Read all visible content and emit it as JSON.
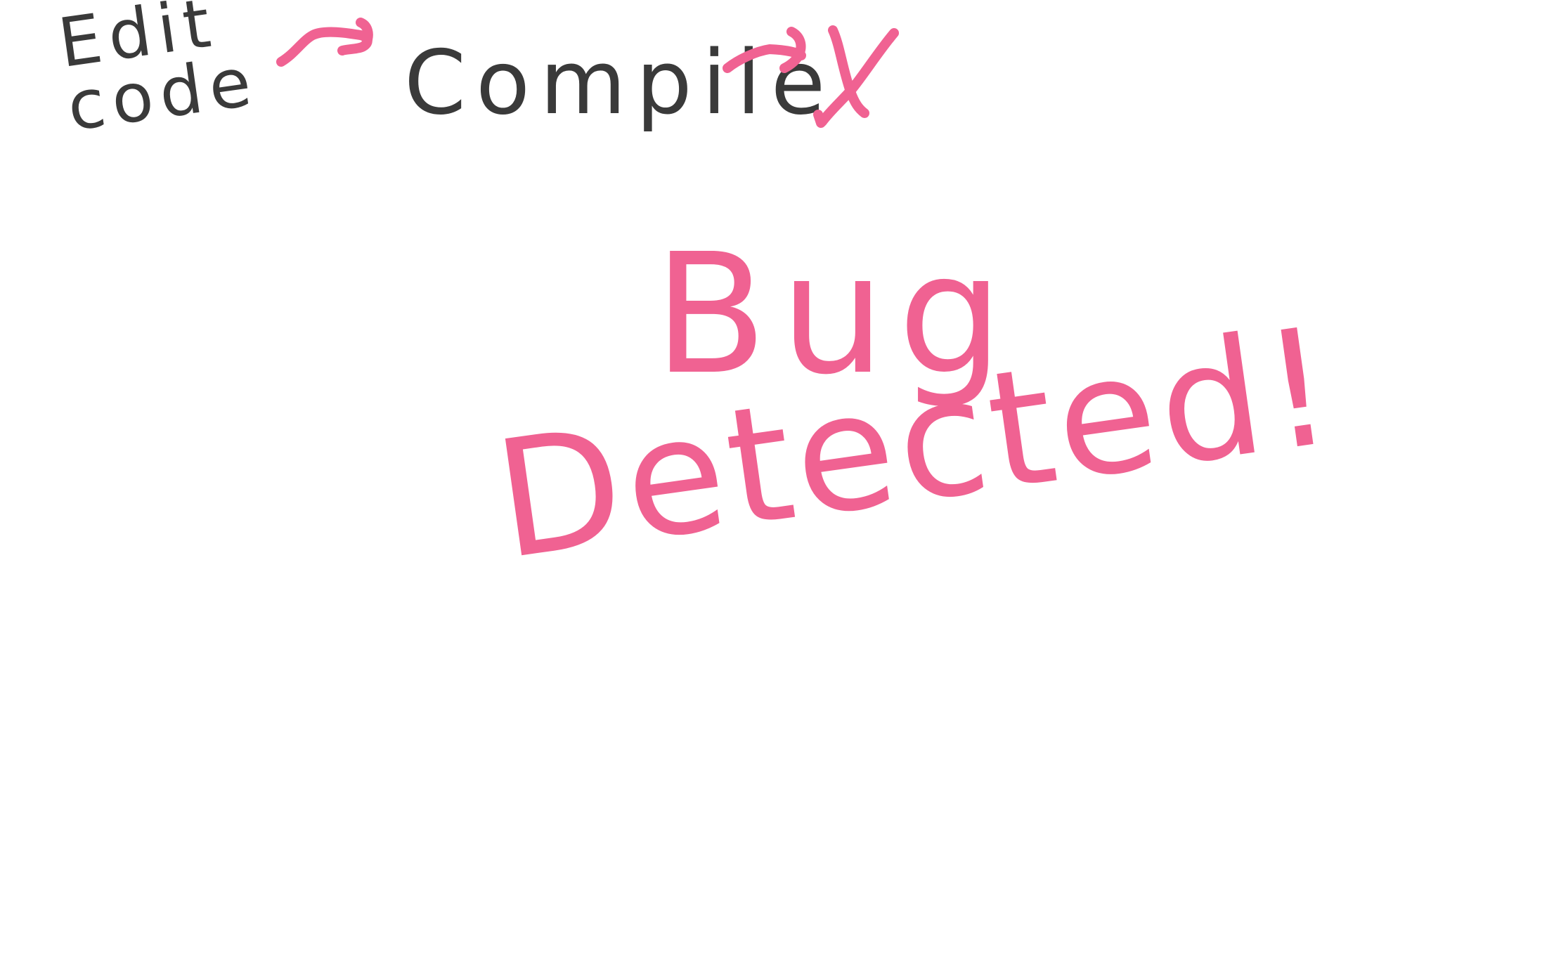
{
  "steps": {
    "edit_code": "Edit\ncode",
    "compile": "Compile",
    "fail_mark": "X"
  },
  "message": {
    "line1": "Bug",
    "line2": "Detected!"
  },
  "colors": {
    "ink_dark": "#3a3a3a",
    "ink_pink": "#f06292",
    "background": "#ffffff"
  },
  "icons": {
    "arrow_1": "arrow-right-icon",
    "arrow_2": "arrow-right-icon",
    "fail": "x-mark-icon"
  }
}
